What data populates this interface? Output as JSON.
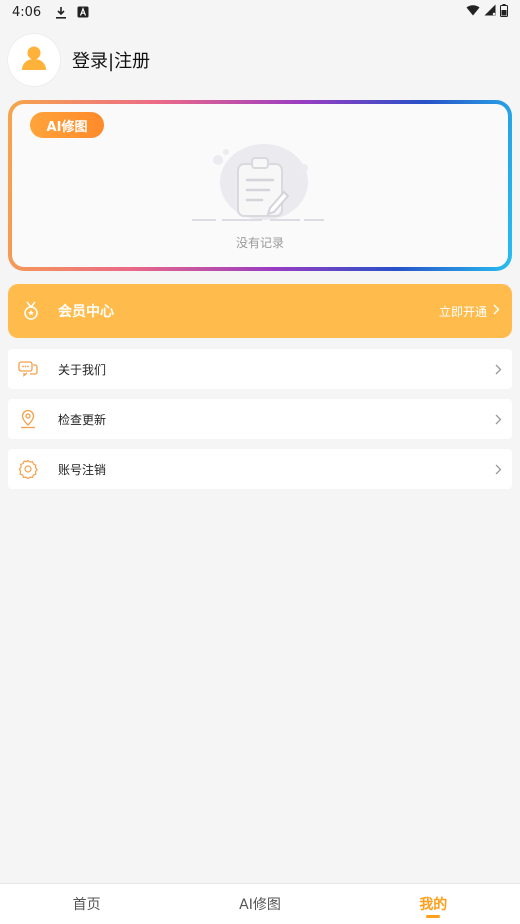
{
  "status_bar": {
    "time": "4:06",
    "icons": [
      "download-icon",
      "a-badge-icon",
      "wifi-icon",
      "signal-icon",
      "battery-icon"
    ]
  },
  "profile": {
    "title": "登录|注册",
    "avatar_icon": "user-icon"
  },
  "ai_card": {
    "badge": "AI修图",
    "empty_text": "没有记录",
    "empty_icon": "clipboard-edit-icon"
  },
  "member": {
    "title": "会员中心",
    "action": "立即开通",
    "icon": "medal-icon"
  },
  "menu": [
    {
      "label": "关于我们",
      "icon": "chat-bubbles-icon"
    },
    {
      "label": "检查更新",
      "icon": "location-pin-icon"
    },
    {
      "label": "账号注销",
      "icon": "gear-icon"
    }
  ],
  "tabs": [
    {
      "label": "首页",
      "active": false
    },
    {
      "label": "AI修图",
      "active": false
    },
    {
      "label": "我的",
      "active": true
    }
  ],
  "colors": {
    "accent": "#ff9f1c",
    "member_bg": "#ffbc4c",
    "badge_bg": "#ffa33a",
    "page_bg": "#f5f5f5"
  }
}
